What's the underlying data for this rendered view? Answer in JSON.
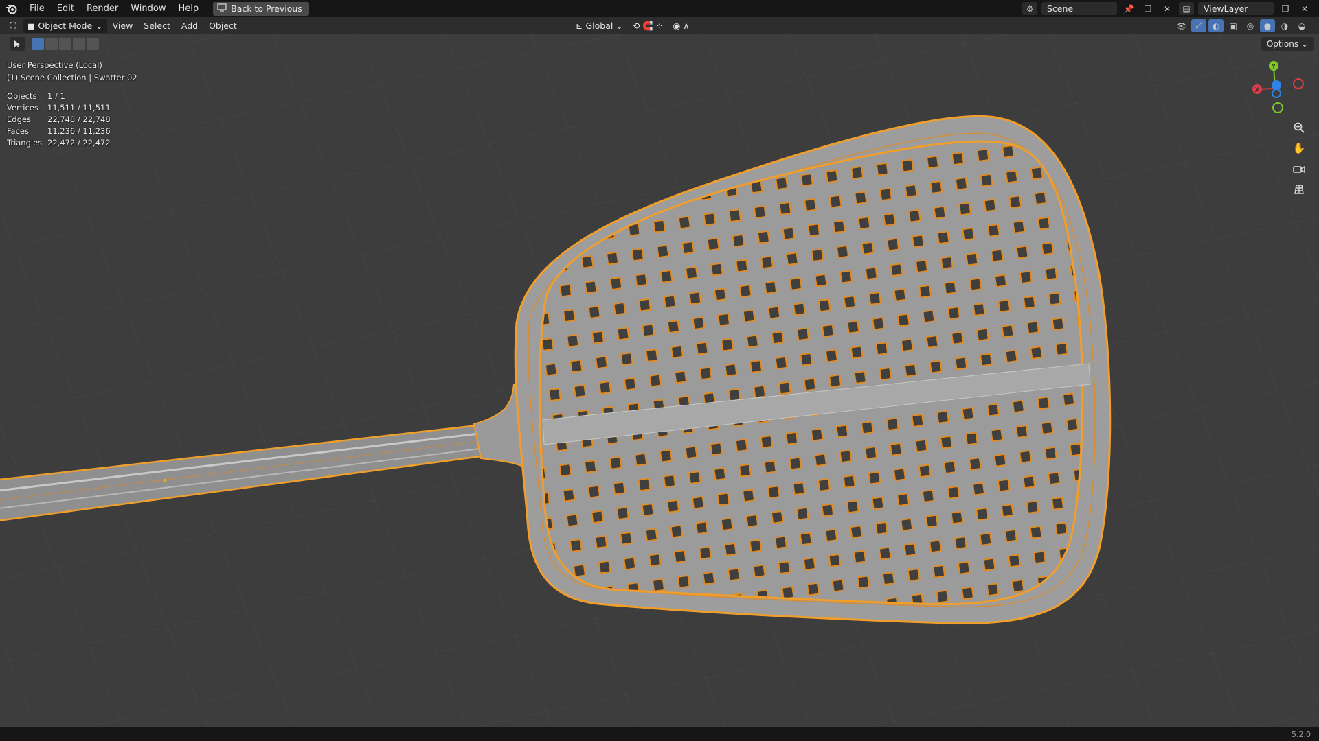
{
  "topbar": {
    "menus": [
      "File",
      "Edit",
      "Render",
      "Window",
      "Help"
    ],
    "back_button": "Back to Previous",
    "scene_name": "Scene",
    "view_layer": "ViewLayer"
  },
  "viewport_header": {
    "mode": "Object Mode",
    "menus": [
      "View",
      "Select",
      "Add",
      "Object"
    ],
    "transform_orientation": "Global"
  },
  "toolbar": {
    "options_label": "Options"
  },
  "overlay": {
    "perspective": "User Perspective (Local)",
    "collection": "(1) Scene Collection | Swatter 02",
    "stats": [
      {
        "label": "Objects",
        "value": "1 / 1"
      },
      {
        "label": "Vertices",
        "value": "11,511 / 11,511"
      },
      {
        "label": "Edges",
        "value": "22,748 / 22,748"
      },
      {
        "label": "Faces",
        "value": "11,236 / 11,236"
      },
      {
        "label": "Triangles",
        "value": "22,472 / 22,472"
      }
    ]
  },
  "gizmo": {
    "x_label": "X",
    "y_label": "Y",
    "colors": {
      "x": "#d93c4a",
      "y": "#7ec62a",
      "z": "#2f83e6"
    }
  },
  "nav_icons": [
    "zoom-icon",
    "pan-hand-icon",
    "camera-icon",
    "grid-view-icon"
  ],
  "statusbar": {
    "version": "5.2.0"
  },
  "colors": {
    "selection_outline": "#f19e2a",
    "accent_blue": "#4772b3",
    "viewport_bg": "#3d3d3d",
    "mesh_gray": "#9a9a9a"
  }
}
